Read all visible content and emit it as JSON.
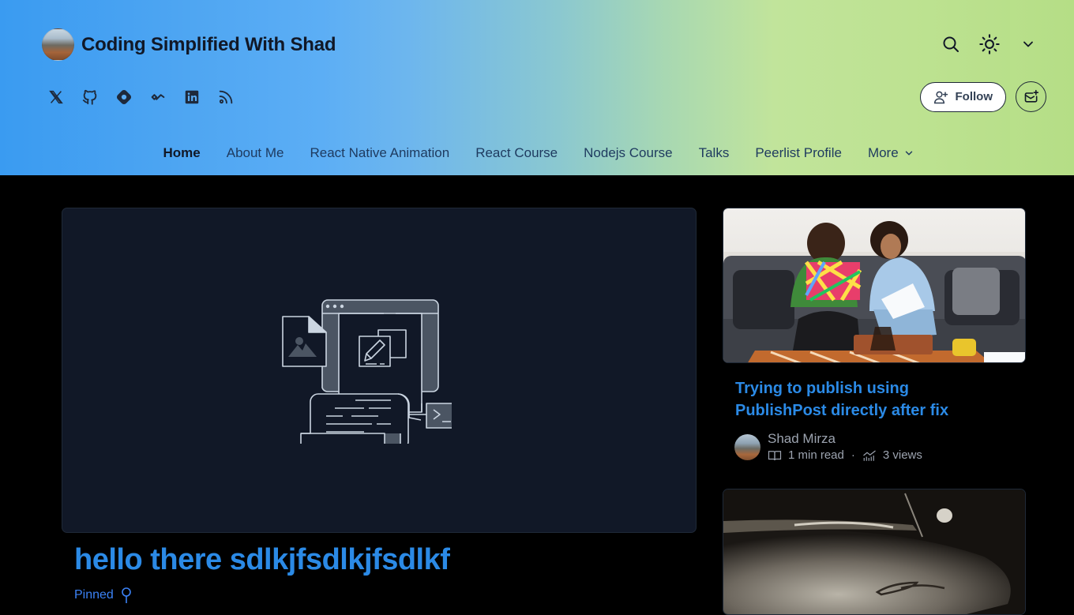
{
  "header": {
    "blog_title": "Coding Simplified With Shad",
    "social_links": [
      {
        "name": "x-icon",
        "label": "X"
      },
      {
        "name": "github-icon",
        "label": "GitHub"
      },
      {
        "name": "hashnode-icon",
        "label": "Hashnode"
      },
      {
        "name": "peerlist-icon",
        "label": "Peerlist"
      },
      {
        "name": "linkedin-icon",
        "label": "LinkedIn"
      },
      {
        "name": "rss-icon",
        "label": "RSS"
      }
    ],
    "actions": {
      "search_icon": "search-icon",
      "theme_icon": "sun-icon",
      "menu_icon": "chevron-down-icon"
    },
    "follow_label": "Follow",
    "newsletter_icon": "newsletter-icon"
  },
  "nav": {
    "items": [
      {
        "label": "Home",
        "active": true
      },
      {
        "label": "About Me"
      },
      {
        "label": "React Native Animation"
      },
      {
        "label": "React Course"
      },
      {
        "label": "Nodejs Course"
      },
      {
        "label": "Talks"
      },
      {
        "label": "Peerlist Profile"
      },
      {
        "label": "More"
      }
    ]
  },
  "featured_post": {
    "title": "hello there sdlkjfsdlkjfsdlkf",
    "pinned_label": "Pinned"
  },
  "side_posts": [
    {
      "title": "Trying to publish using PublishPost directly after fix",
      "author": "Shad Mirza",
      "read_time": "1 min read",
      "views": "3 views"
    }
  ],
  "colors": {
    "accent": "#2b8ae6",
    "pinned": "#3b82f6",
    "card_bg": "#111827",
    "page_bg": "#000000",
    "muted_text": "#9ca3af"
  }
}
